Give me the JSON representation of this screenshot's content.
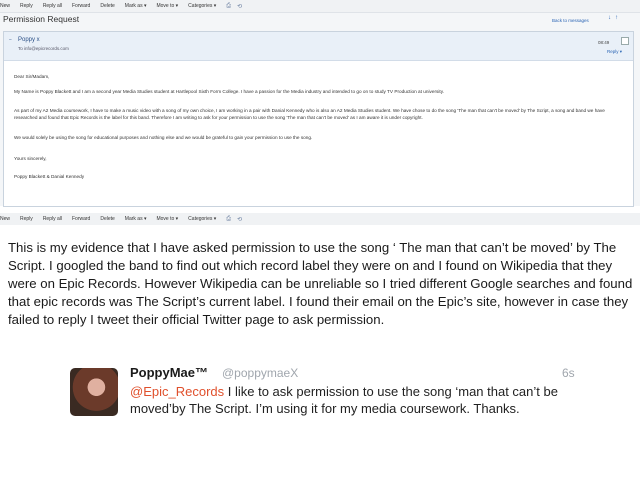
{
  "toolbar_top": [
    "New",
    "Reply",
    "Reply all",
    "Forward",
    "Delete",
    "Mark as ▾",
    "Move to ▾",
    "Categories ▾"
  ],
  "toolbar_bottom": [
    "New",
    "Reply",
    "Reply all",
    "Forward",
    "Delete",
    "Mark as ▾",
    "Move to ▾",
    "Categories ▾"
  ],
  "toolbar_icons": [
    "print-icon",
    "sync-icon"
  ],
  "subject": "Permission Request",
  "back_to_messages": "Back to messages",
  "sender": {
    "name": "Poppy x",
    "to": "To info@epicrecords.com",
    "time": "08:49",
    "reply": "Reply ▾"
  },
  "email_body": {
    "greeting": "Dear Sir/Madam,",
    "para1": "My Name is Poppy Blackett and I am a second year Media Studies student at Hartlepool Sixth Form College. I have a passion for the Media industry and intended to go on to study TV Production at university.",
    "para2": "As part of my A2 Media coursework, I have to make a music video with a song of my own choice, I am working in a pair with Danial Kennedy who is also an A2 Media Studies student. We have chose to do the song 'The man that can't be moved' by The Script, a song and band we have researched and found that Epic Records is the label for this band. Therefore I am writing to ask for your permission to use the song 'The man that can't be moved' as I am aware it is under copyright.",
    "para3": "We would solely be using the song for educational purposes and nothing else and we would be grateful to gain your permission to use the song.",
    "closing": "Yours sincerely,",
    "signature": "Poppy Blackett & Danial Kennedy"
  },
  "main_text": "This is my evidence that I have asked permission to use the song ‘ The man that can’t be moved’ by The Script. I googled the band to find out which record label they were on and I found on Wikipedia that they were on Epic Records. However Wikipedia can be unreliable so I tried different Google searches and found that epic records was The Script’s current label. I found their email on the Epic’s site, however in case they failed to reply I tweet their official Twitter page to ask permission.",
  "tweet": {
    "name": "PoppyMae™",
    "handle": "@poppymaeX",
    "time": "6s",
    "mention": "@Epic_Records",
    "text": " I like to ask permission to use the song ‘man that can’t be moved’by The Script. I’m using it for my media coursework. Thanks."
  },
  "colors": {
    "link": "#2a64b4",
    "mention": "#e0502c",
    "sender_bar": "#e9f0f8"
  }
}
